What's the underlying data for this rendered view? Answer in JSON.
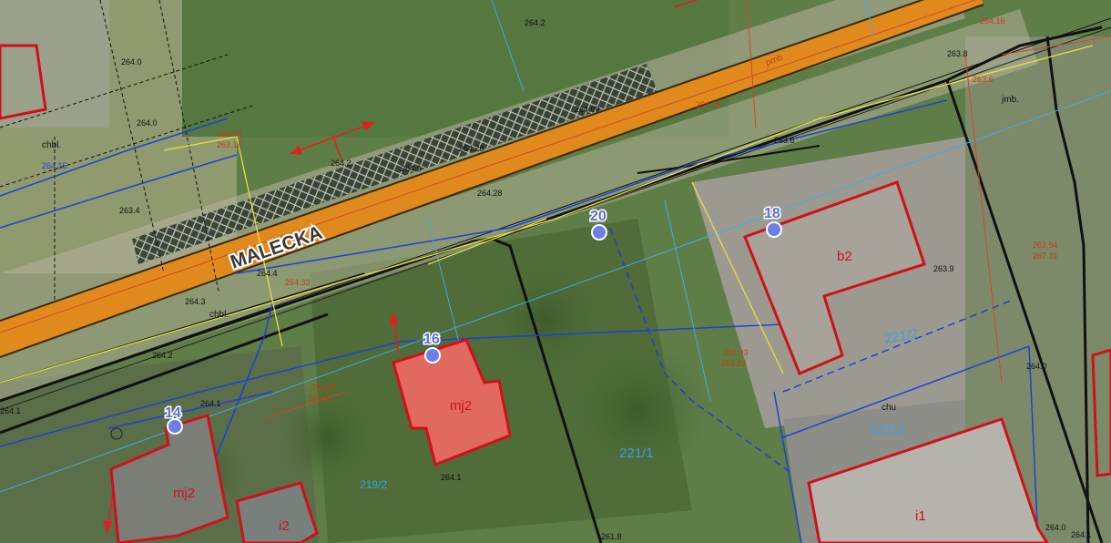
{
  "street": {
    "name": "MALECKA"
  },
  "colors": {
    "road": "#e08a1e",
    "building_outline": "#d0101a",
    "parcel_line": "#111111",
    "utility_blue": "#1f3fd8",
    "address_marker": "#6b7fe6",
    "grass": "#5f7d47"
  },
  "address_markers": [
    {
      "number": "14"
    },
    {
      "number": "16"
    },
    {
      "number": "18"
    },
    {
      "number": "20"
    }
  ],
  "building_labels": {
    "mj2_left": "mj2",
    "mj2_center": "mj2",
    "i2": "i2",
    "b2": "b2",
    "i1": "i1"
  },
  "parcel_labels": {
    "p221_1": "221/1",
    "p221_2": "221/2",
    "p221_3": "221/3",
    "p219_2": "219/2"
  },
  "landuse_labels": {
    "chbl_left": "chbl.",
    "chbl_mid": "chbl.",
    "chu": "chu",
    "jmb": "jmb.",
    "pmb": "pmb"
  },
  "elevations": [
    "264.2",
    "264.0",
    "264.0",
    "264.15",
    "263.4",
    "264.2",
    "264.3",
    "264.28",
    "264.09",
    "264.28",
    "264.4",
    "264.33",
    "264.3",
    "264.2",
    "264.1",
    "264.1",
    "264.1",
    "263.9",
    "264.0",
    "264.0",
    "264.1",
    "263.8",
    "263.6",
    "264.16",
    "263.94",
    "263.14",
    "264.16",
    "263.95",
    "263.91",
    "263.93",
    "263.94",
    "267.31",
    "263.83",
    "261.8",
    "263.6",
    "264.0",
    "264.1"
  ]
}
